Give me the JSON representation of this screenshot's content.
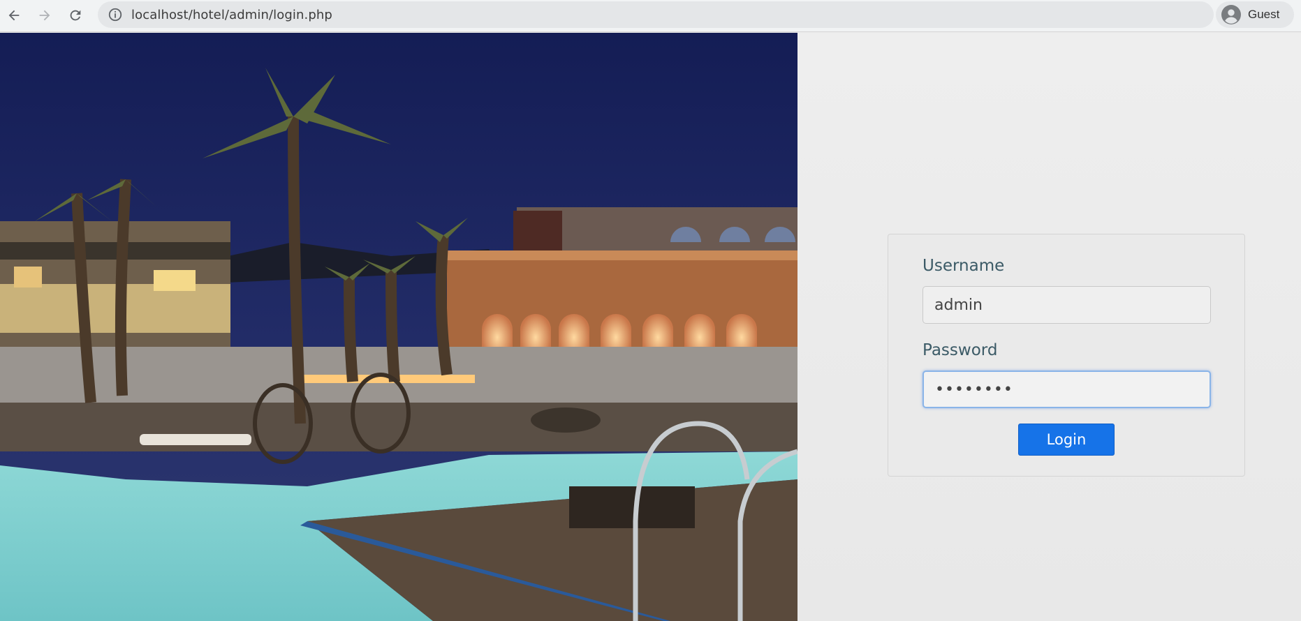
{
  "browser": {
    "url": "localhost/hotel/admin/login.php",
    "profile": "Guest",
    "icons": [
      "back-arrow-icon",
      "forward-arrow-icon",
      "reload-icon",
      "site-info-icon",
      "profile-avatar-icon"
    ]
  },
  "login_form": {
    "username_label": "Username",
    "username_value": "admin",
    "password_label": "Password",
    "password_value": "••••••••",
    "submit_label": "Login"
  },
  "colors": {
    "primary_button": "#1673e8",
    "label_text": "#3b5a66",
    "focus_ring": "#8ab4e8"
  }
}
